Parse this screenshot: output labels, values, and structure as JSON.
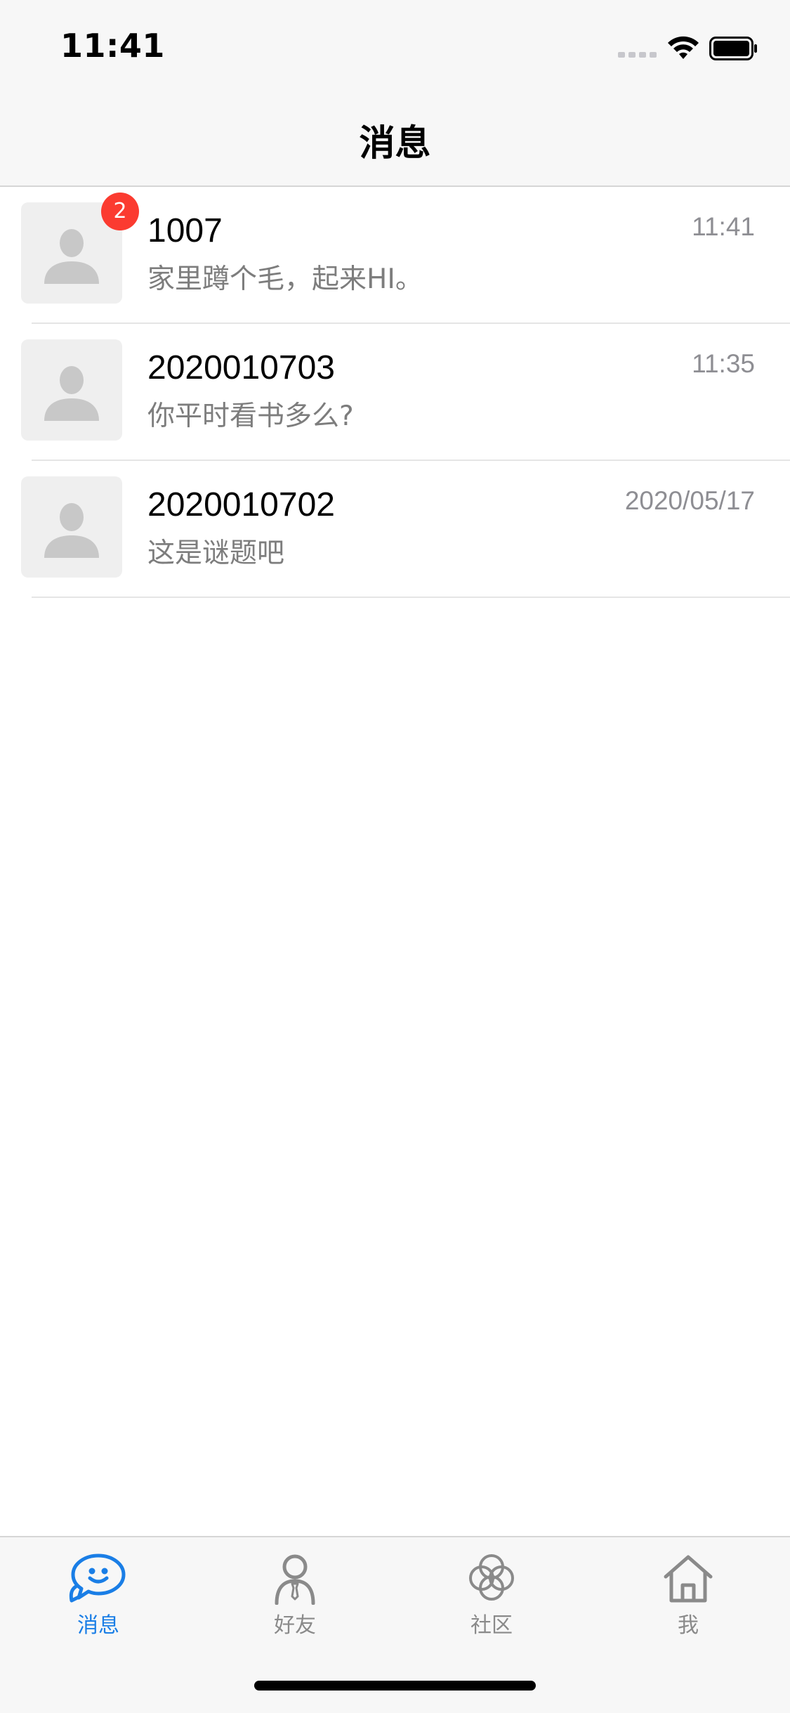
{
  "status_bar": {
    "time": "11:41"
  },
  "header": {
    "title": "消息"
  },
  "conversations": [
    {
      "name": "1007",
      "preview": "家里蹲个毛，起来HI。",
      "time": "11:41",
      "unread": "2"
    },
    {
      "name": "2020010703",
      "preview": "你平时看书多么?",
      "time": "11:35"
    },
    {
      "name": "2020010702",
      "preview": "这是谜题吧",
      "time": "2020/05/17"
    }
  ],
  "tabs": [
    {
      "label": "消息",
      "icon": "chat-bubble-icon",
      "active": true
    },
    {
      "label": "好友",
      "icon": "person-icon",
      "active": false
    },
    {
      "label": "社区",
      "icon": "community-rings-icon",
      "active": false
    },
    {
      "label": "我",
      "icon": "home-icon",
      "active": false
    }
  ],
  "colors": {
    "accent": "#1a7ee6",
    "badge": "#fb3b30",
    "inactive": "#8a8a8a"
  }
}
